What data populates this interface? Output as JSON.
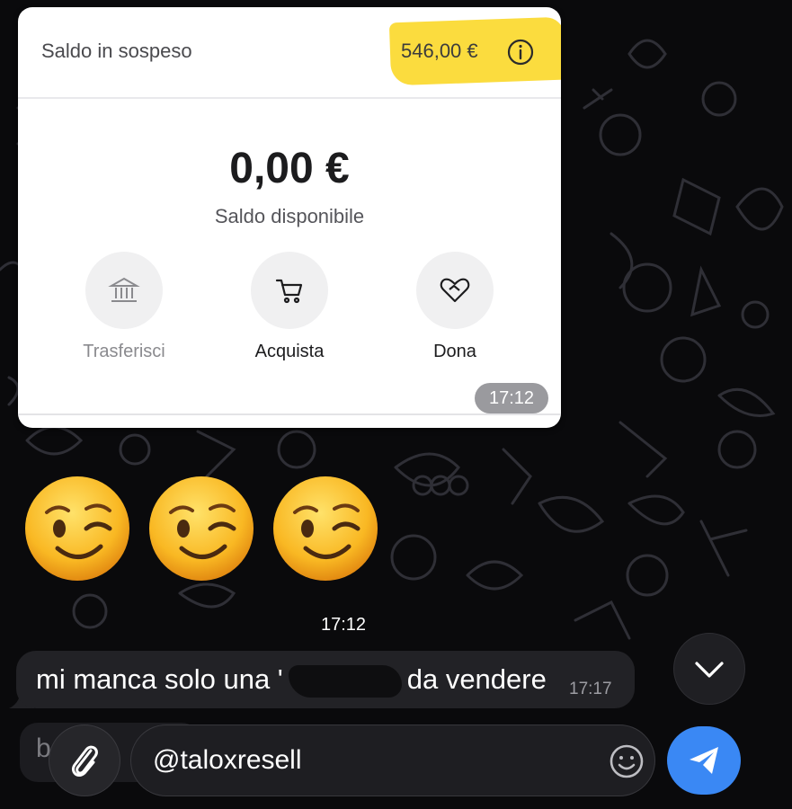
{
  "screenshot_card": {
    "pending_label": "Saldo in sospeso",
    "pending_amount": "546,00 €",
    "available_amount": "0,00 €",
    "available_label": "Saldo disponibile",
    "actions": [
      {
        "label": "Trasferisci",
        "icon": "bank-icon",
        "enabled": false
      },
      {
        "label": "Acquista",
        "icon": "cart-icon",
        "enabled": true
      },
      {
        "label": "Dona",
        "icon": "heart-icon",
        "enabled": true
      }
    ],
    "highlight_color": "#fad61c",
    "time": "17:12"
  },
  "emoji_message": {
    "emoji": [
      "winking-face",
      "winking-face",
      "winking-face"
    ],
    "time": "17:12"
  },
  "text_message": {
    "text_before": "mi manca solo una '",
    "text_after": "da vendere",
    "time": "17:17"
  },
  "composer": {
    "behind_text": "b     e",
    "input_value": "@taloxresell",
    "send_color": "#3a88f4"
  }
}
